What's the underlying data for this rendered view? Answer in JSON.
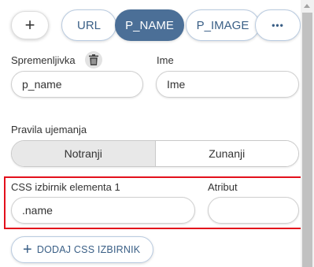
{
  "tabs": {
    "add_label": "+",
    "items": [
      {
        "label": "URL",
        "active": false
      },
      {
        "label": "P_NAME",
        "active": true
      },
      {
        "label": "P_IMAGE",
        "active": false
      }
    ],
    "more_label": "•••"
  },
  "variable": {
    "label": "Spremenljivka",
    "value": "p_name",
    "delete_icon": "trash-icon"
  },
  "name": {
    "label": "Ime",
    "value": "Ime"
  },
  "matching": {
    "label": "Pravila ujemanja",
    "options": [
      {
        "label": "Notranji",
        "selected": true
      },
      {
        "label": "Zunanji",
        "selected": false
      }
    ]
  },
  "css_selector": {
    "label": "CSS izbirnik elementa 1",
    "value": ".name",
    "attribute_label": "Atribut",
    "attribute_value": ""
  },
  "add_css_button": {
    "icon": "+",
    "label": "DODAJ CSS IZBIRNIK"
  },
  "colors": {
    "accent": "#4b6f97",
    "highlight": "#e3101c"
  }
}
